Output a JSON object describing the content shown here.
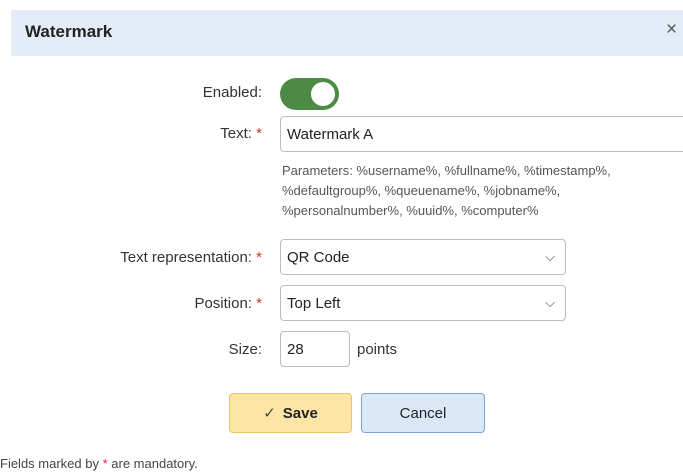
{
  "dialog": {
    "title": "Watermark",
    "close_glyph": "×"
  },
  "form": {
    "enabled": {
      "label": "Enabled:",
      "value": true
    },
    "text": {
      "label": "Text:",
      "required_mark": "*",
      "value": "Watermark A",
      "help": "Parameters: %username%, %fullname%, %timestamp%, %defaultgroup%, %queuename%, %jobname%, %personalnumber%, %uuid%, %computer%"
    },
    "representation": {
      "label": "Text representation:",
      "required_mark": "*",
      "value": "QR Code",
      "chevron_glyph": "⌵"
    },
    "position": {
      "label": "Position:",
      "required_mark": "*",
      "value": "Top Left",
      "chevron_glyph": "⌵"
    },
    "size": {
      "label": "Size:",
      "value": "28",
      "unit": "points"
    }
  },
  "buttons": {
    "save_check": "✓",
    "save_label": "Save",
    "cancel_label": "Cancel"
  },
  "footer": {
    "text_before": "Fields marked by ",
    "required_mark": "*",
    "text_after": " are mandatory."
  },
  "colors": {
    "header_bg": "#e3ecf7",
    "toggle_on": "#4d8a45",
    "required": "#cc3333",
    "save_bg": "#fde5a6",
    "cancel_bg": "#dbe8f8"
  },
  "icons": [
    "close-icon",
    "chevron-down-icon",
    "check-icon"
  ]
}
